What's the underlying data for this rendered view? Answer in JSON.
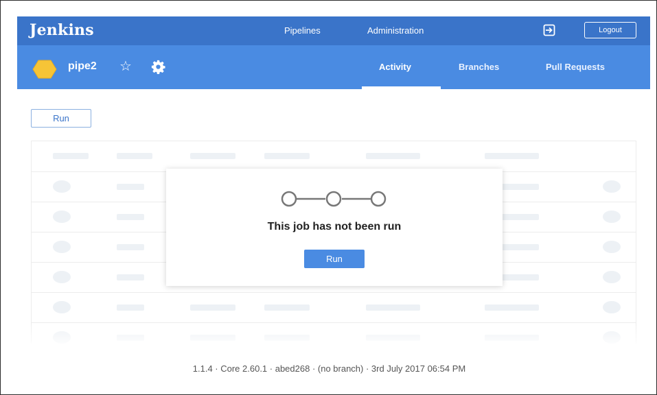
{
  "app": {
    "brand": "Jenkins"
  },
  "topnav": {
    "pipelines": "Pipelines",
    "administration": "Administration",
    "logout": "Logout"
  },
  "pipeline": {
    "name": "pipe2",
    "weather_icon": "sunny-weather-icon",
    "star_icon": "☆"
  },
  "tabs": [
    {
      "label": "Activity",
      "active": true
    },
    {
      "label": "Branches",
      "active": false
    },
    {
      "label": "Pull Requests",
      "active": false
    }
  ],
  "actions": {
    "run": "Run"
  },
  "empty_state": {
    "title": "This job has not been run",
    "run": "Run"
  },
  "footer": {
    "text": "1.1.4 · Core 2.60.1 · abed268 · (no branch) · 3rd July 2017 06:54 PM"
  },
  "colors": {
    "topbar": "#3a74c9",
    "subbar": "#4a8be2",
    "accent": "#4a8be2",
    "weather": "#f6c437",
    "skeleton": "#edf1f5"
  }
}
